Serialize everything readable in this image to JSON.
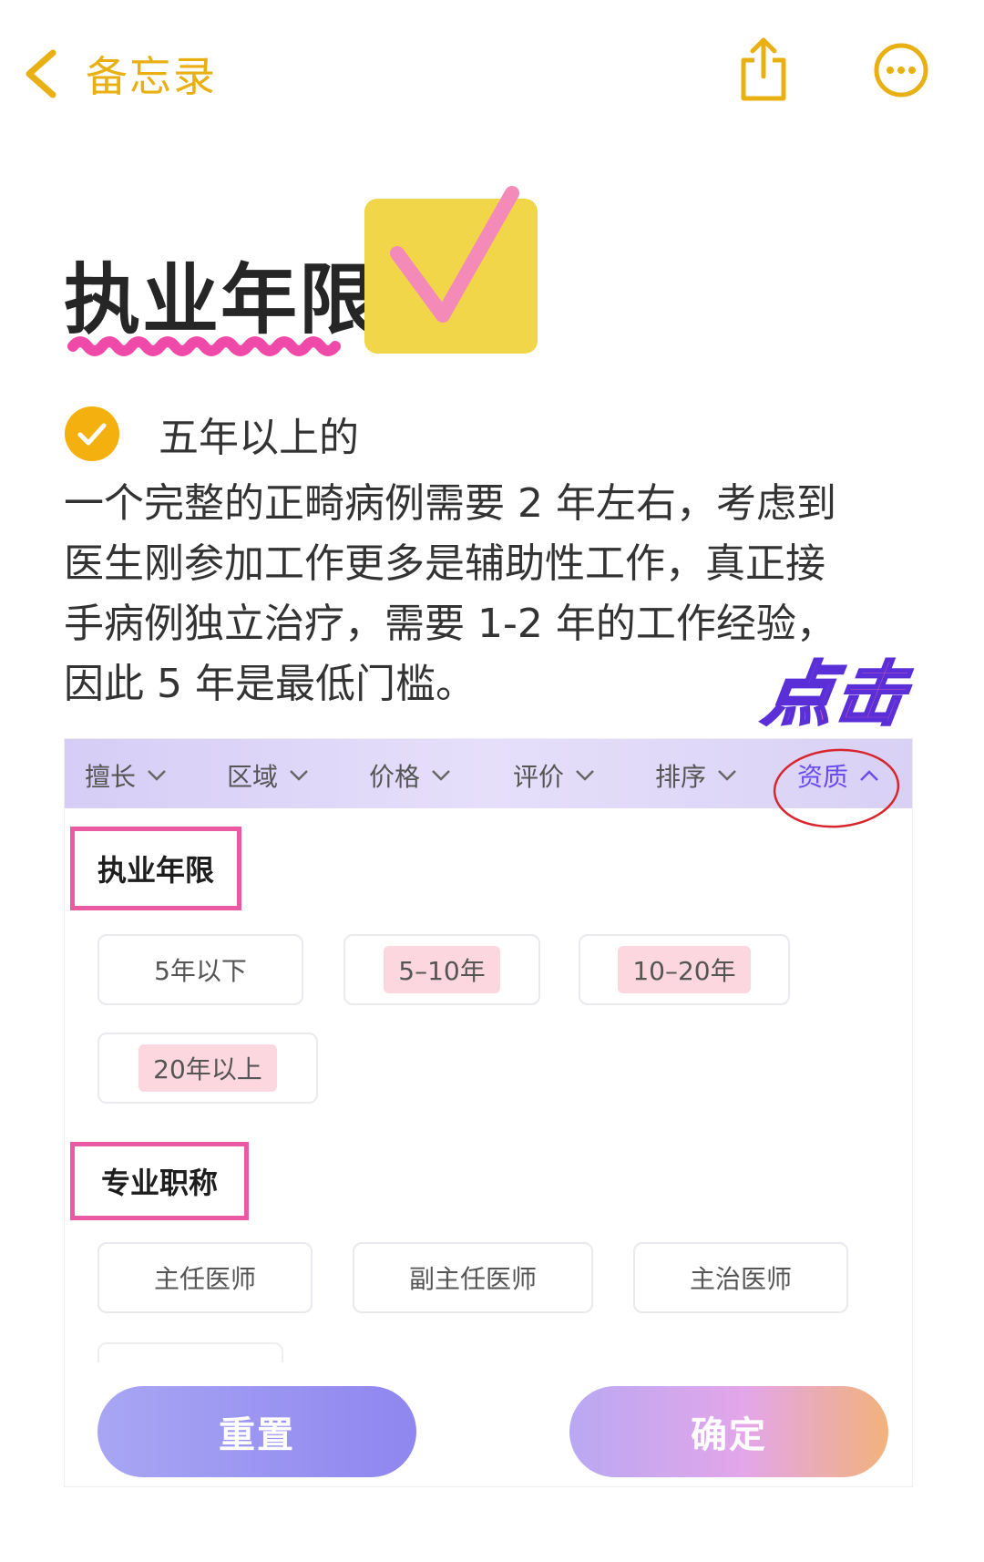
{
  "nav": {
    "back_label": "备忘录",
    "share_icon": "share-icon",
    "more_icon": "more-icon",
    "accent_color": "#e8b012"
  },
  "note": {
    "title": "执业年限",
    "bullet_text": "五年以上的",
    "paragraph_lines": [
      "一个完整的正畸病例需要 2 年左右，考虑到",
      "医生刚参加工作更多是辅助性工作，真正接",
      "手病例独立治疗，需要 1-2 年的工作经验，",
      "因此 5 年是最低门槛。"
    ],
    "annotation": "点击"
  },
  "filter": {
    "tabs": [
      "擅长",
      "区域",
      "价格",
      "评价",
      "排序",
      "资质"
    ],
    "active_tab": "资质",
    "section1_title": "执业年限",
    "section1_options": [
      "5年以下",
      "5–10年",
      "10–20年",
      "20年以上"
    ],
    "section2_title": "专业职称",
    "section2_options": [
      "主任医师",
      "副主任医师",
      "主治医师"
    ],
    "reset_label": "重置",
    "confirm_label": "确定"
  }
}
